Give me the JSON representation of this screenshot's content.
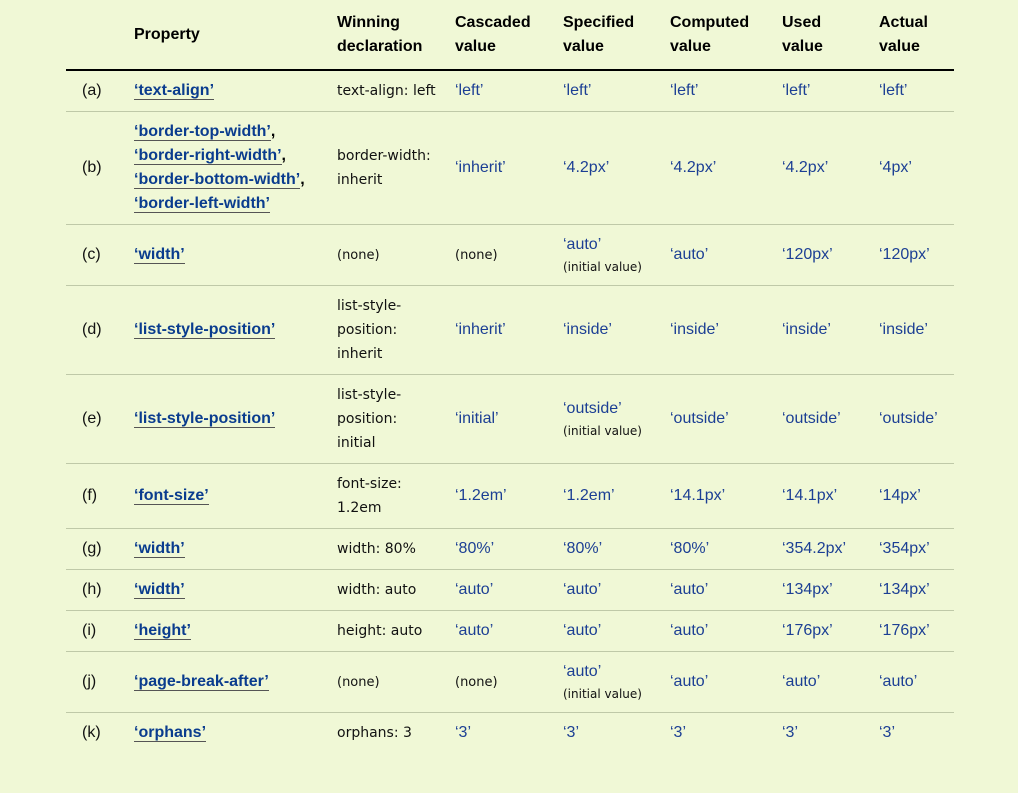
{
  "headers": {
    "label": "",
    "property": "Property",
    "winning": "Winning declaration",
    "cascaded": "Cascaded value",
    "specified": "Specified value",
    "computed": "Computed value",
    "used": "Used value",
    "actual": "Actual value"
  },
  "rows": [
    {
      "label": "(a)",
      "props": [
        "‘text-align’"
      ],
      "winning": "text-align: left",
      "cascaded": "‘left’",
      "specified": "‘left’",
      "specified_note": "",
      "computed": "‘left’",
      "used": "‘left’",
      "actual": "‘left’"
    },
    {
      "label": "(b)",
      "props": [
        "‘border-top-width’",
        "‘border-right-width’",
        "‘border-bottom-width’",
        "‘border-left-width’"
      ],
      "winning": "border-width: inherit",
      "cascaded": "‘inherit’",
      "specified": "‘4.2px’",
      "specified_note": "",
      "computed": "‘4.2px’",
      "used": "‘4.2px’",
      "actual": "‘4px’"
    },
    {
      "label": "(c)",
      "props": [
        "‘width’"
      ],
      "winning": "(none)",
      "cascaded": "(none)",
      "specified": "‘auto’",
      "specified_note": "(initial value)",
      "computed": "‘auto’",
      "used": "‘120px’",
      "actual": "‘120px’"
    },
    {
      "label": "(d)",
      "props": [
        "‘list-style-position’"
      ],
      "winning": "list-style-position: inherit",
      "cascaded": "‘inherit’",
      "specified": "‘inside’",
      "specified_note": "",
      "computed": "‘inside’",
      "used": "‘inside’",
      "actual": "‘inside’"
    },
    {
      "label": "(e)",
      "props": [
        "‘list-style-position’"
      ],
      "winning": "list-style-position: initial",
      "cascaded": "‘initial’",
      "specified": "‘outside’",
      "specified_note": "(initial value)",
      "computed": "‘outside’",
      "used": "‘outside’",
      "actual": "‘outside’"
    },
    {
      "label": "(f)",
      "props": [
        "‘font-size’"
      ],
      "winning": "font-size: 1.2em",
      "cascaded": "‘1.2em’",
      "specified": "‘1.2em’",
      "specified_note": "",
      "computed": "‘14.1px’",
      "used": "‘14.1px’",
      "actual": "‘14px’"
    },
    {
      "label": "(g)",
      "props": [
        "‘width’"
      ],
      "winning": "width: 80%",
      "cascaded": "‘80%’",
      "specified": "‘80%’",
      "specified_note": "",
      "computed": "‘80%’",
      "used": "‘354.2px’",
      "actual": "‘354px’"
    },
    {
      "label": "(h)",
      "props": [
        "‘width’"
      ],
      "winning": "width: auto",
      "cascaded": "‘auto’",
      "specified": "‘auto’",
      "specified_note": "",
      "computed": "‘auto’",
      "used": "‘134px’",
      "actual": "‘134px’"
    },
    {
      "label": "(i)",
      "props": [
        "‘height’"
      ],
      "winning": "height: auto",
      "cascaded": "‘auto’",
      "specified": "‘auto’",
      "specified_note": "",
      "computed": "‘auto’",
      "used": "‘176px’",
      "actual": "‘176px’"
    },
    {
      "label": "(j)",
      "props": [
        "‘page-break-after’"
      ],
      "winning": "(none)",
      "cascaded": "(none)",
      "specified": "‘auto’",
      "specified_note": "(initial value)",
      "computed": "‘auto’",
      "used": "‘auto’",
      "actual": "‘auto’"
    },
    {
      "label": "(k)",
      "props": [
        "‘orphans’"
      ],
      "winning": "orphans: 3",
      "cascaded": "‘3’",
      "specified": "‘3’",
      "specified_note": "",
      "computed": "‘3’",
      "used": "‘3’",
      "actual": "‘3’"
    }
  ],
  "colors": {
    "background": "#f0f8d6",
    "link": "#0a3c8e",
    "value": "#1c3f94"
  }
}
